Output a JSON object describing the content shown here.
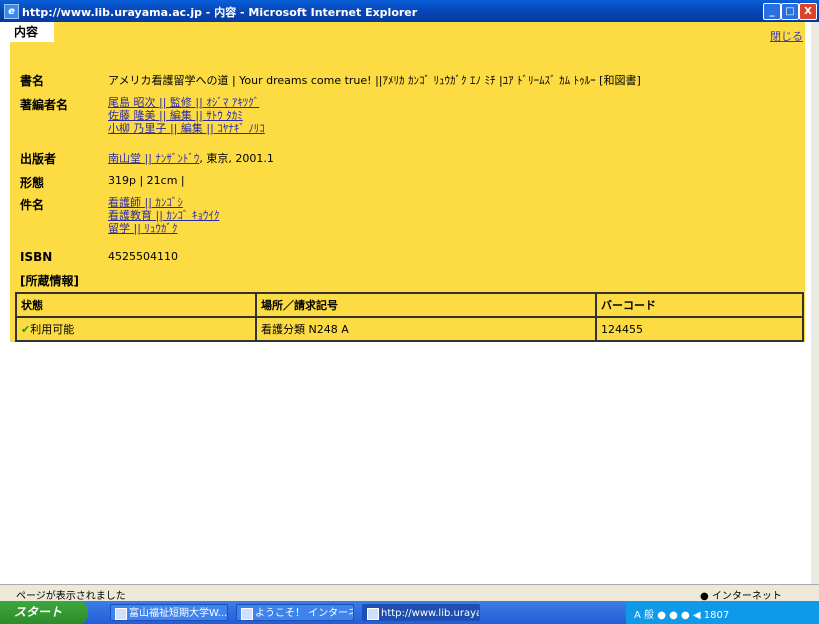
{
  "window": {
    "title": "http://www.lib.urayama.ac.jp - 内容 - Microsoft Internet Explorer",
    "minimize": "_",
    "maximize": "□",
    "close": "X"
  },
  "page": {
    "tab_label": "内容",
    "close_link": "閉じる"
  },
  "record": {
    "title_label": "書名",
    "title_value": "アメリカ看護留学への道 | Your dreams come true! ||ｱﾒﾘｶ ｶﾝｺﾞ ﾘｭｳｶﾞｸ ｴﾉ ﾐﾁ |ﾕｱ ﾄﾞﾘｰﾑｽﾞ ｶﾑ ﾄｩﾙｰ [和図書]",
    "author_label": "著編者名",
    "authors": [
      "尾島 昭次 || 監修 || ｵｼﾞﾏ ｱｷﾂｸﾞ",
      "佐藤 隆美 || 編集 || ｻﾄｳ ﾀｶﾐ",
      "小柳 乃里子 || 編集 || ｺﾔﾅｷﾞ ﾉﾘｺ"
    ],
    "publisher_label": "出版者",
    "publisher_link": "南山堂 || ﾅﾝｻﾞﾝﾄﾞｳ",
    "publisher_rest": ", 東京, 2001.1",
    "form_label": "形態",
    "form_value": "319p | 21cm |",
    "subject_label": "件名",
    "subjects": [
      "看護師 || ｶﾝｺﾞｼ",
      "看護教育 || ｶﾝｺﾞ ｷｮｳｲｸ",
      "留学 || ﾘｭｳｶﾞｸ"
    ],
    "isbn_label": "ISBN",
    "isbn_value": "4525504110",
    "holdings_heading": "[所蔵情報]"
  },
  "holdings": {
    "headers": [
      "状態",
      "場所／請求記号",
      "バーコード"
    ],
    "rows": [
      {
        "status": "利用可能",
        "location": "看護分類 N248 A",
        "barcode": "124455"
      }
    ]
  },
  "statusbar": {
    "text": "ページが表示されました",
    "zone": "インターネット"
  },
  "taskbar": {
    "start": "スタート",
    "items": [
      "富山福祉短期大学W...",
      "ようこそ！ インターネ...",
      "http://www.lib.uraya..."
    ],
    "tray_text": "A 般 ● ● ● ◀ 1807"
  }
}
